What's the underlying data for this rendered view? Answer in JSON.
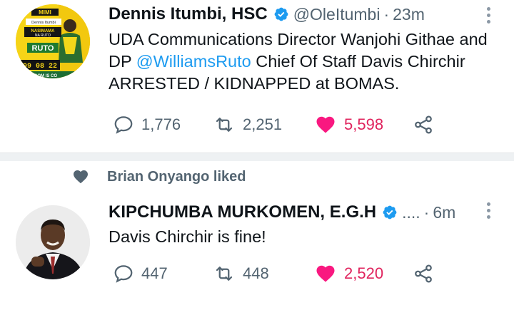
{
  "tweet1": {
    "name": "Dennis Itumbi, HSC",
    "handle": "@OleItumbi",
    "separator": "·",
    "time": "23m",
    "text_part1": "UDA Communications Director Wanjohi Githae and DP ",
    "mention": "@WilliamsRuto",
    "text_part2": " Chief Of Staff Davis Chirchir ARRESTED / KIDNAPPED at BOMAS.",
    "replies": "1,776",
    "retweets": "2,251",
    "likes": "5,598",
    "avatar": {
      "line1": "MIMI",
      "line2": "Dennis Itumbi",
      "line3": "NASIMAMA",
      "line4": "NA RUTO",
      "brand": "RUTO",
      "date": "09 08 22",
      "footer": "EDOM IS CO"
    }
  },
  "social_context": {
    "text": "Brian Onyango liked"
  },
  "tweet2": {
    "name": "KIPCHUMBA MURKOMEN, E.G.H",
    "truncated_handle": "....",
    "separator": "·",
    "time": "6m",
    "text": "Davis Chirchir is fine!",
    "replies": "447",
    "retweets": "448",
    "likes": "2,520"
  },
  "colors": {
    "verified": "#1d9bf0",
    "like": "#f91880",
    "mention": "#1d9bf0",
    "muted": "#536471"
  },
  "icons": [
    "verified-icon",
    "more-icon",
    "reply-icon",
    "retweet-icon",
    "like-icon",
    "share-icon"
  ]
}
